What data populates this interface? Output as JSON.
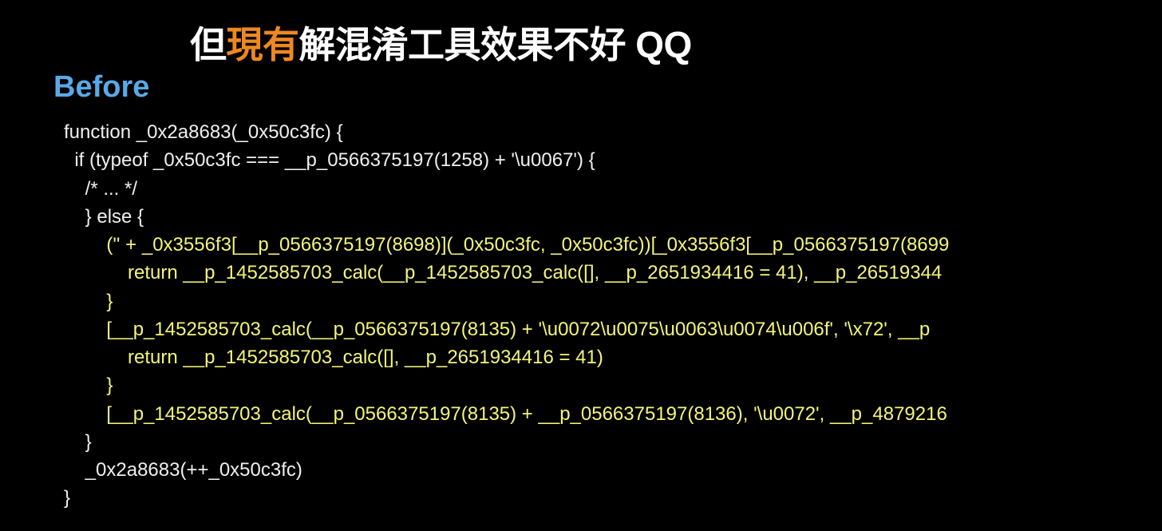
{
  "title": {
    "prefix": "但",
    "highlight": "現有",
    "suffix": "解混淆工具效果不好 QQ"
  },
  "section_label": "Before",
  "code": {
    "lines": [
      {
        "cls": "",
        "text": "function _0x2a8683(_0x50c3fc) {"
      },
      {
        "cls": "",
        "text": "  if (typeof _0x50c3fc === __p_0566375197(1258) + '\\u0067') {"
      },
      {
        "cls": "",
        "text": "    /* ... */"
      },
      {
        "cls": "",
        "text": "    } else {"
      },
      {
        "cls": "yellow",
        "text": "        ('' + _0x3556f3[__p_0566375197(8698)](_0x50c3fc, _0x50c3fc))[_0x3556f3[__p_0566375197(8699"
      },
      {
        "cls": "yellow",
        "text": "            return __p_1452585703_calc(__p_1452585703_calc([], __p_2651934416 = 41), __p_26519344"
      },
      {
        "cls": "yellow",
        "text": "        }"
      },
      {
        "cls": "yellow",
        "text": "        [__p_1452585703_calc(__p_0566375197(8135) + '\\u0072\\u0075\\u0063\\u0074\\u006f', '\\x72', __p"
      },
      {
        "cls": "yellow",
        "text": "            return __p_1452585703_calc([], __p_2651934416 = 41)"
      },
      {
        "cls": "yellow",
        "text": "        }"
      },
      {
        "cls": "yellow",
        "text": "        [__p_1452585703_calc(__p_0566375197(8135) + __p_0566375197(8136), '\\u0072', __p_4879216"
      },
      {
        "cls": "",
        "text": "    }"
      },
      {
        "cls": "",
        "text": "    _0x2a8683(++_0x50c3fc)"
      },
      {
        "cls": "",
        "text": "}"
      }
    ]
  }
}
